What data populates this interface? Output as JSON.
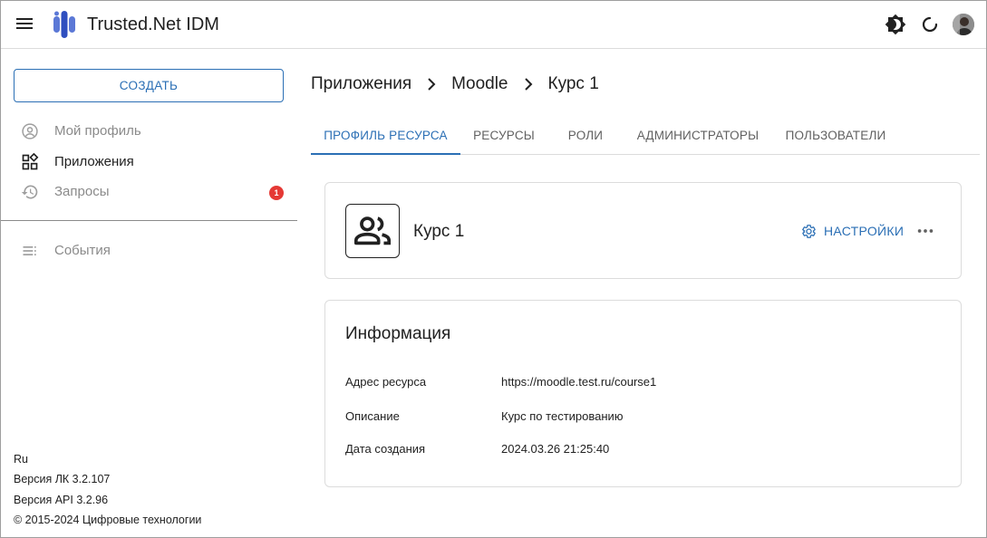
{
  "header": {
    "title": "Trusted.Net IDM",
    "icons": [
      "menu-icon",
      "logo-icon",
      "theme-icon",
      "refresh-icon",
      "avatar"
    ]
  },
  "sidebar": {
    "create_label": "СОЗДАТЬ",
    "items": [
      {
        "label": "Мой профиль",
        "icon": "account-circle-icon",
        "state": "disabled"
      },
      {
        "label": "Приложения",
        "icon": "apps-icon",
        "state": "active"
      },
      {
        "label": "Запросы",
        "icon": "history-icon",
        "state": "disabled",
        "badge": "1"
      },
      {
        "label": "События",
        "icon": "list-icon",
        "state": "disabled"
      }
    ],
    "footer": {
      "lang": "Ru",
      "version_lk": "Версия ЛК 3.2.107",
      "version_api": "Версия API 3.2.96",
      "copyright": "© 2015-2024 Цифровые технологии"
    }
  },
  "breadcrumb": [
    "Приложения",
    "Moodle",
    "Курс 1"
  ],
  "tabs": [
    {
      "label": "ПРОФИЛЬ РЕСУРСА",
      "active": true
    },
    {
      "label": "РЕСУРСЫ",
      "active": false
    },
    {
      "label": "РОЛИ",
      "active": false
    },
    {
      "label": "АДМИНИСТРАТОРЫ",
      "active": false
    },
    {
      "label": "ПОЛЬЗОВАТЕЛИ",
      "active": false
    }
  ],
  "resource": {
    "name": "Курс 1",
    "icon": "group-icon",
    "settings_label": "НАСТРОЙКИ"
  },
  "info": {
    "title": "Информация",
    "rows": [
      {
        "label": "Адрес ресурса",
        "value": "https://moodle.test.ru/course1"
      },
      {
        "label": "Описание",
        "value": "Курс по тестированию"
      },
      {
        "label": "Дата создания",
        "value": "2024.03.26 21:25:40"
      }
    ]
  },
  "colors": {
    "accent": "#2b6fb5",
    "badge": "#e53935",
    "text": "#212121",
    "muted": "#8a8a8a"
  }
}
